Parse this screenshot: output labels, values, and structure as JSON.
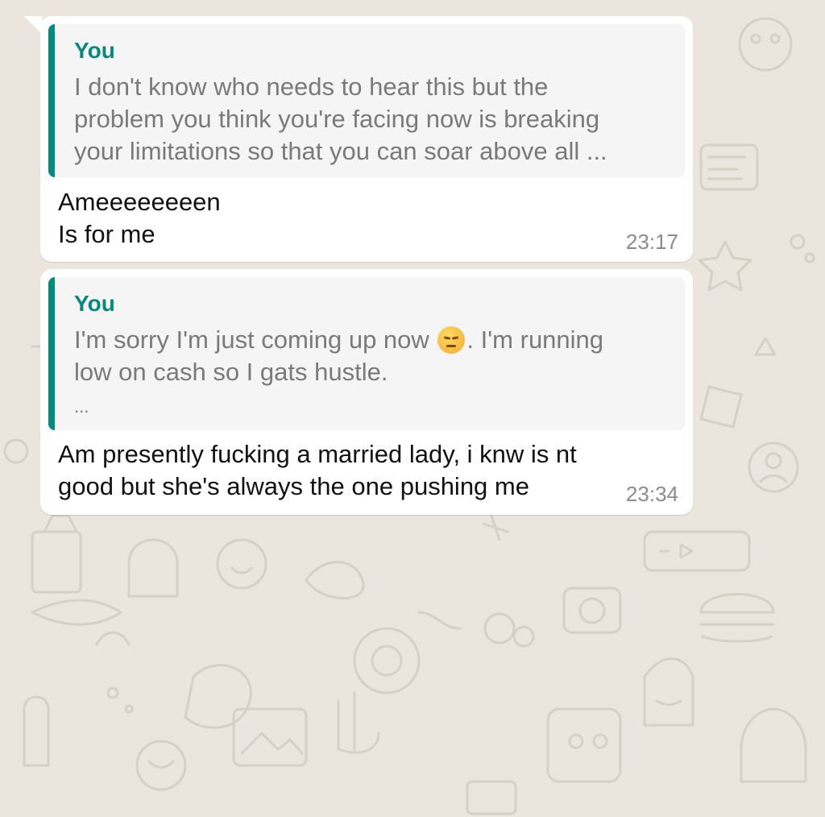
{
  "theme": {
    "chat_background": "#ece5dd",
    "bubble_color": "#ffffff",
    "quote_accent": "#07897b"
  },
  "messages": [
    {
      "quoted": {
        "author": "You",
        "text": "I don't know who needs to hear this but the\nproblem you think you're facing now is breaking\nyour limitations so that you can soar above all ..."
      },
      "text": "Ameeeeeeeen\nIs for me",
      "time": "23:17"
    },
    {
      "quoted": {
        "author": "You",
        "text_before_emoji": "I'm sorry I'm just coming up now",
        "emoji": "pensive-face-icon",
        "text_after_emoji": ". I'm running\nlow on cash so I gats hustle.",
        "ellipsis": "..."
      },
      "text": "Am presently fucking a married lady, i knw is nt\ngood but she's always the one pushing me",
      "time": "23:34"
    }
  ]
}
